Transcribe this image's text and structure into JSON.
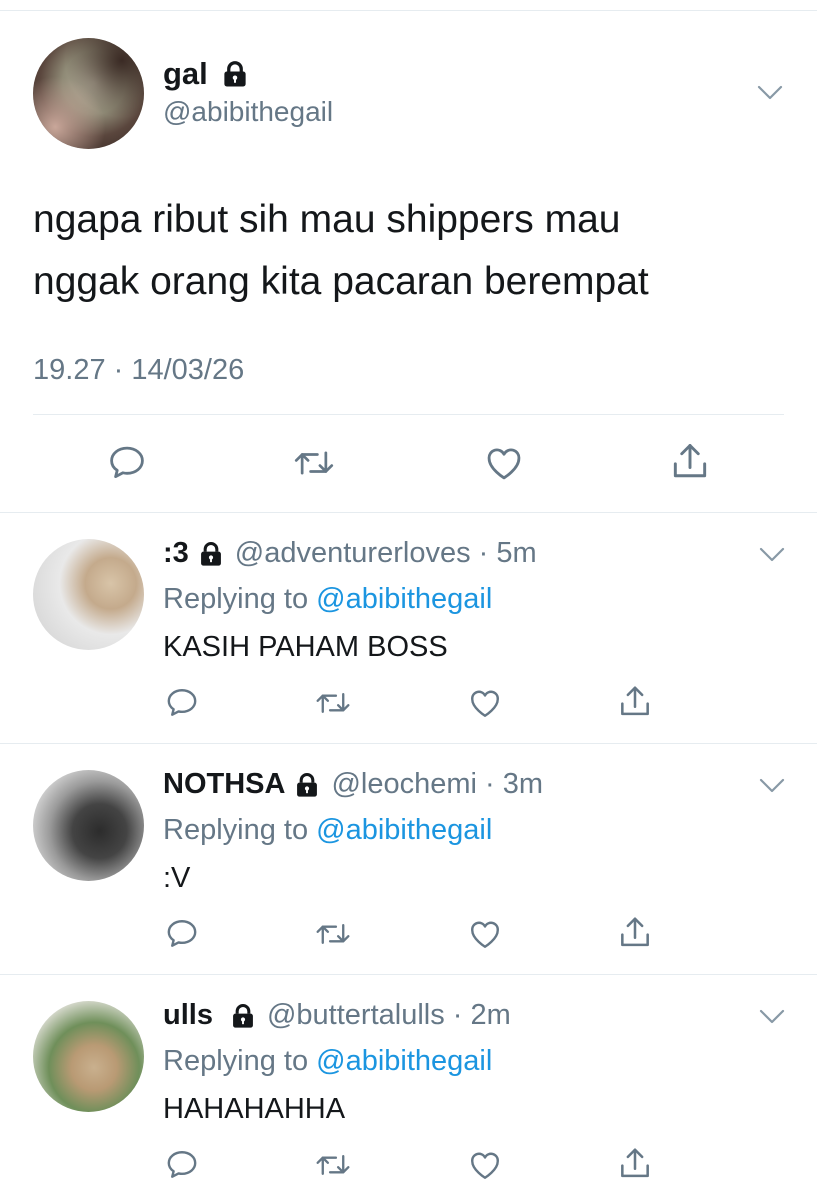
{
  "main_tweet": {
    "display_name": "gal",
    "handle": "@abibithegail",
    "text_line1": "ngapa ribut sih mau shippers mau",
    "text_line2": "nggak orang kita pacaran berempat",
    "timestamp": "19.27 · 14/03/26"
  },
  "replies": [
    {
      "display_name": ":3",
      "handle_time": "@adventurerloves · 5m",
      "replying_prefix": "Replying to ",
      "replying_handle": "@abibithegail",
      "text": "KASIH PAHAM BOSS"
    },
    {
      "display_name": "NOTHSA",
      "handle_time": "@leochemi · 3m",
      "replying_prefix": "Replying to ",
      "replying_handle": "@abibithegail",
      "text": ":V"
    },
    {
      "display_name": "ulls",
      "handle_time": "@buttertalulls · 2m",
      "replying_prefix": "Replying to ",
      "replying_handle": "@abibithegail",
      "text": "HAHAHAHHA"
    }
  ],
  "colors": {
    "text": "#14171a",
    "secondary": "#657786",
    "link": "#1b95e0",
    "divider": "#e6ecf0"
  },
  "icons": [
    "lock-icon",
    "chevron-down-icon",
    "reply-icon",
    "retweet-icon",
    "like-icon",
    "share-icon"
  ]
}
